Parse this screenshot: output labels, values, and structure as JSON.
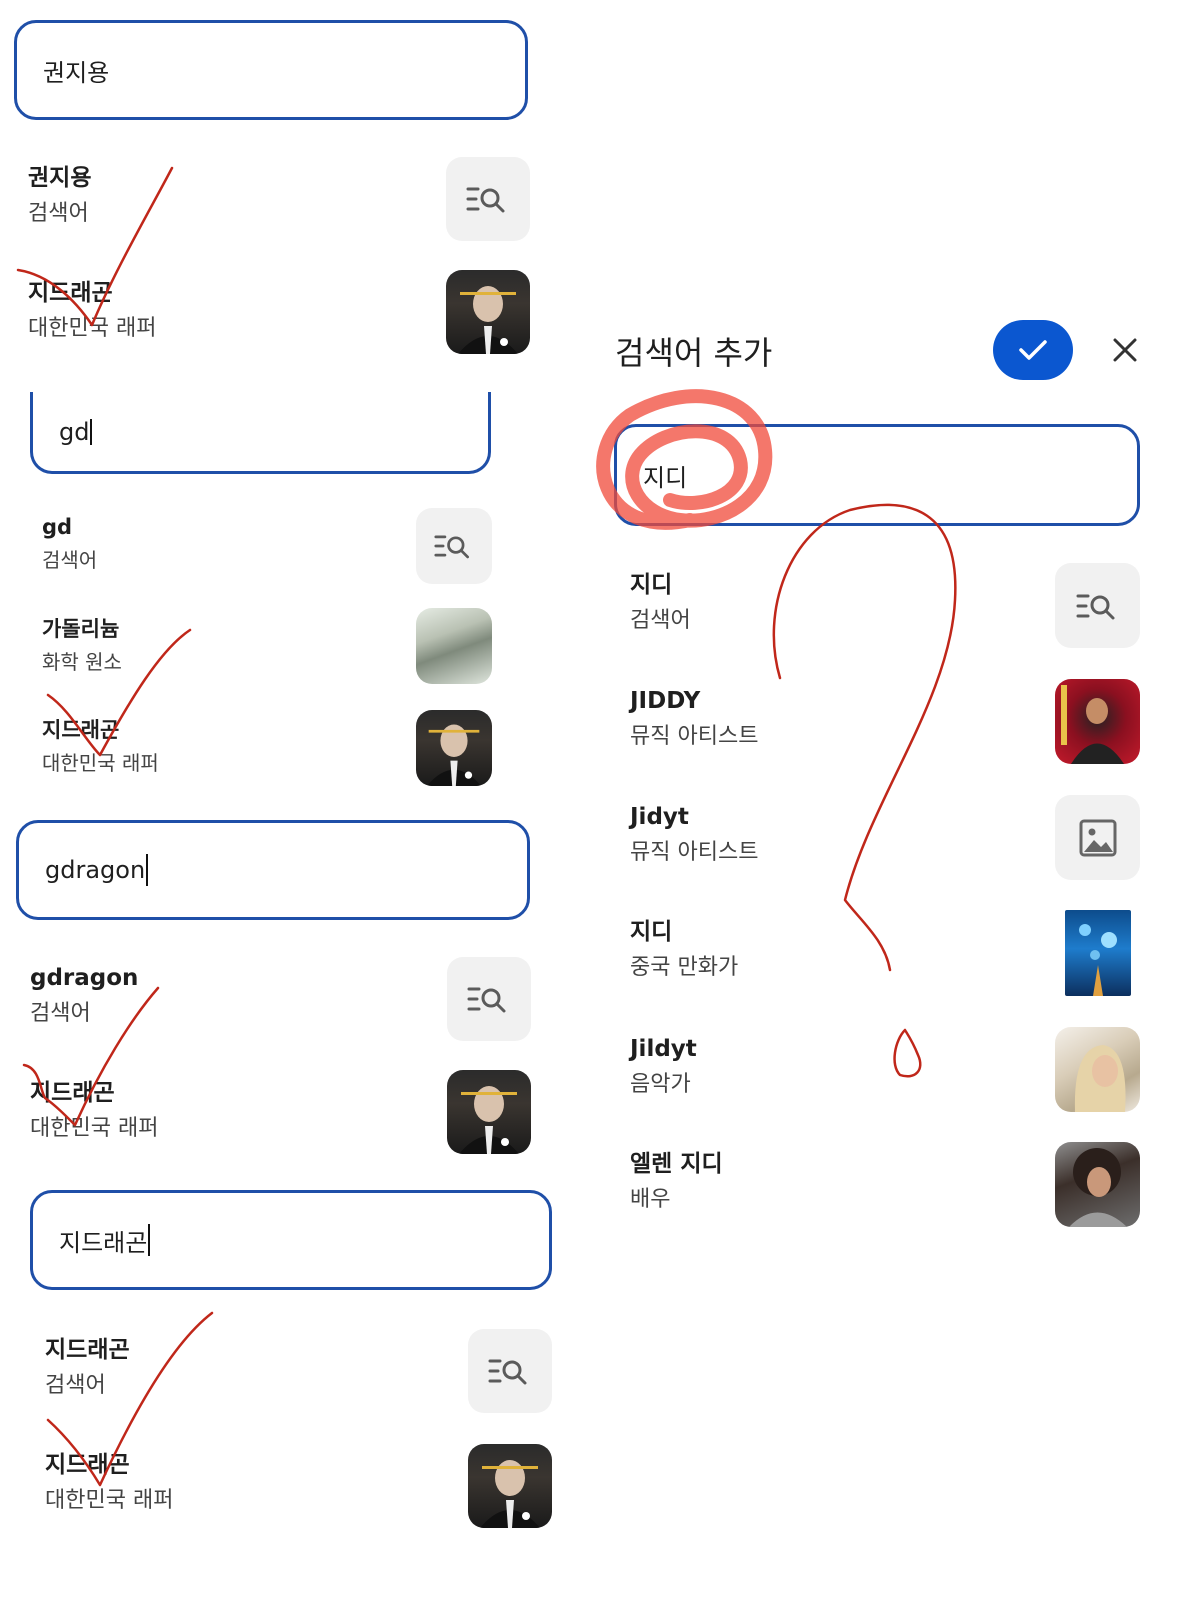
{
  "left_panel": {
    "groups": [
      {
        "input_value": "권지용",
        "results": [
          {
            "title": "권지용",
            "subtitle": "검색어",
            "thumb": "search-list-icon"
          },
          {
            "title": "지드래곤",
            "subtitle": "대한민국 래퍼",
            "thumb": "photo"
          }
        ]
      },
      {
        "input_value": "gd",
        "results": [
          {
            "title": "gd",
            "subtitle": "검색어",
            "thumb": "search-list-icon"
          },
          {
            "title": "가돌리늄",
            "subtitle": "화학 원소",
            "thumb": "photo"
          },
          {
            "title": "지드래곤",
            "subtitle": "대한민국 래퍼",
            "thumb": "photo"
          }
        ]
      },
      {
        "input_value": "gdragon",
        "results": [
          {
            "title": "gdragon",
            "subtitle": "검색어",
            "thumb": "search-list-icon"
          },
          {
            "title": "지드래곤",
            "subtitle": "대한민국 래퍼",
            "thumb": "photo"
          }
        ]
      },
      {
        "input_value": "지드래곤",
        "results": [
          {
            "title": "지드래곤",
            "subtitle": "검색어",
            "thumb": "search-list-icon"
          },
          {
            "title": "지드래곤",
            "subtitle": "대한민국 래퍼",
            "thumb": "photo"
          }
        ]
      }
    ]
  },
  "dialog": {
    "title": "검색어 추가",
    "confirm_icon": "check-icon",
    "close_icon": "close-icon",
    "input_value": "지디",
    "results": [
      {
        "title": "지디",
        "subtitle": "검색어",
        "thumb": "search-list-icon"
      },
      {
        "title": "JIDDY",
        "subtitle": "뮤직 아티스트",
        "thumb": "photo"
      },
      {
        "title": "Jidyt",
        "subtitle": "뮤직 아티스트",
        "thumb": "image-placeholder-icon"
      },
      {
        "title": "지디",
        "subtitle": "중국 만화가",
        "thumb": "photo"
      },
      {
        "title": "Jildyt",
        "subtitle": "음악가",
        "thumb": "photo"
      },
      {
        "title": "엘렌 지디",
        "subtitle": "배우",
        "thumb": "photo"
      }
    ]
  },
  "colors": {
    "input_border": "#1f4fa8",
    "confirm_button": "#0b57d0",
    "annotation_red": "#c0271a",
    "highlight_circle": "#f04a3a"
  }
}
